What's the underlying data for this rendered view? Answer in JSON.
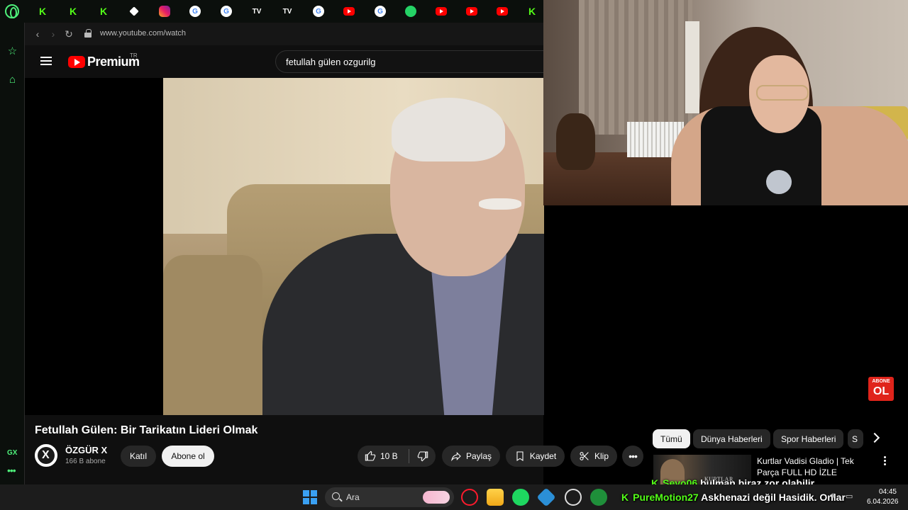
{
  "browser": {
    "url": "www.youtube.com/watch",
    "tab_icons": [
      "opera-logo",
      "kick-icon",
      "kick-icon",
      "kick-icon",
      "diamond-icon",
      "instagram-icon",
      "google-icon",
      "google-icon",
      "tv-icon",
      "tv-icon",
      "google-icon",
      "youtube-icon",
      "google-icon",
      "whatsapp-icon",
      "youtube-icon",
      "youtube-icon",
      "youtube-icon",
      "kick-icon"
    ],
    "sidebar_gx": "GX"
  },
  "youtube": {
    "brand": "Premium",
    "region": "TR",
    "search_query": "fetullah gülen  ozgurilg",
    "video_title": "Fetullah Gülen: Bir Tarikatın Lideri Olmak",
    "channel_name": "ÖZGÜR X",
    "channel_subs": "166 B abone",
    "join_label": "Katıl",
    "subscribe_label": "Abone ol",
    "like_count": "10 B",
    "share_label": "Paylaş",
    "save_label": "Kaydet",
    "clip_label": "Klip",
    "badge_top": "ABONE",
    "badge_bottom": "OL",
    "chips": [
      "Tümü",
      "Dünya Haberleri",
      "Spor Haberleri",
      "S"
    ],
    "recommendation": {
      "title": "Kurtlar Vadisi Gladio | Tek Parça FULL HD İZLE",
      "thumb_text": "KURTLAR VADİSİ"
    }
  },
  "chat": [
    {
      "user": "Seyo06",
      "user_color": "#53fc18",
      "message": "bulman biraz zor olabilir"
    },
    {
      "user": "PureMotion27",
      "user_color": "#53fc18",
      "message": "Askhenazi değil Hasidik. Onlar"
    }
  ],
  "taskbar": {
    "search_placeholder": "Ara",
    "time": "04:45",
    "date": "6.04.2026"
  }
}
